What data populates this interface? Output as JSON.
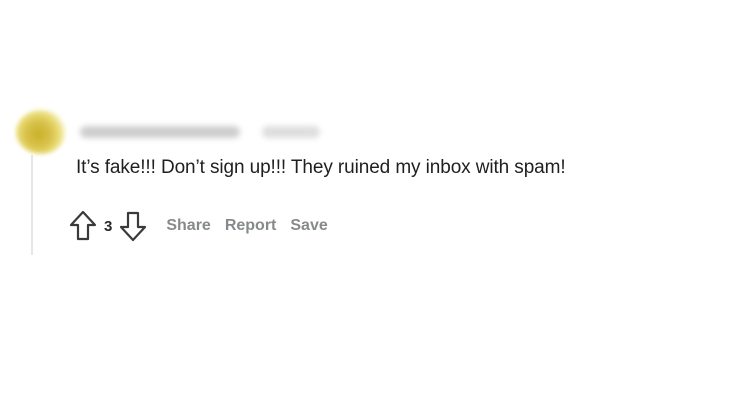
{
  "comment": {
    "body": "It’s fake!!! Don’t sign up!!! They ruined my inbox with spam!",
    "vote_count": "3"
  },
  "actions": {
    "share_label": "Share",
    "report_label": "Report",
    "save_label": "Save"
  },
  "icons": {
    "upvote": "upvote-arrow-icon",
    "downvote": "downvote-arrow-icon"
  },
  "colors": {
    "text": "#1f1f1f",
    "action_text": "#878a8c",
    "avatar": "#d8c24a"
  }
}
